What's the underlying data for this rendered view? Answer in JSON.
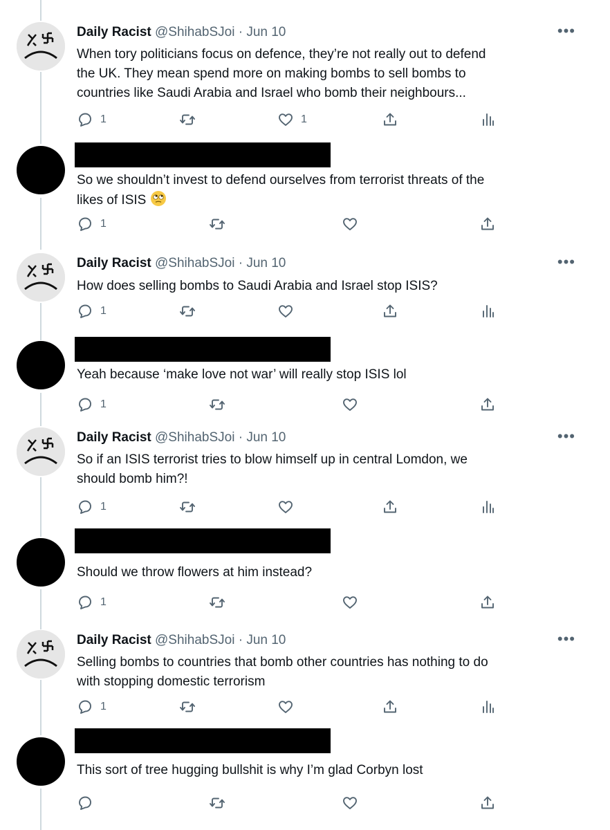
{
  "author": {
    "name": "Daily Racist",
    "handle": "@ShihabSJoi",
    "dot": "·"
  },
  "more_label": "•••",
  "tweets": [
    {
      "type": "author",
      "date": "Jun 10",
      "lines": [
        "When tory politicians focus on defence, they’re not really out to defend",
        "the UK. They mean spend more on making bombs to sell bombs to",
        "countries like Saudi Arabia and Israel who bomb their neighbours..."
      ],
      "reply_count": "1",
      "like_count": "1"
    },
    {
      "type": "reply",
      "lines": [
        "So we shouldn’t invest to defend ourselves from terrorist threats of the",
        "likes of ISIS"
      ],
      "emoji": "rolling-eyes-emoji",
      "reply_count": "1",
      "like_count": ""
    },
    {
      "type": "author",
      "date": "Jun 10",
      "lines": [
        "How does selling bombs to Saudi Arabia and Israel stop ISIS?"
      ],
      "reply_count": "1",
      "like_count": ""
    },
    {
      "type": "reply",
      "lines": [
        "Yeah because ‘make love not war’ will really stop ISIS lol"
      ],
      "reply_count": "1",
      "like_count": ""
    },
    {
      "type": "author",
      "date": "Jun 10",
      "lines": [
        "So if an ISIS terrorist tries to blow himself up in central Lomdon, we",
        "should bomb him?!"
      ],
      "reply_count": "1",
      "like_count": ""
    },
    {
      "type": "reply",
      "lines": [
        "Should we throw flowers at him instead?"
      ],
      "reply_count": "1",
      "like_count": ""
    },
    {
      "type": "author",
      "date": "Jun 10",
      "lines": [
        "Selling bombs to countries that bomb other countries has nothing to do",
        "with stopping domestic terrorism"
      ],
      "reply_count": "1",
      "like_count": ""
    },
    {
      "type": "reply",
      "lines": [
        "This sort of tree hugging bullshit is why I’m glad Corbyn lost"
      ],
      "reply_count": "",
      "like_count": ""
    }
  ],
  "colors": {
    "text": "#0f1419",
    "muted": "#536471",
    "thread_line": "#cfd9de",
    "redaction": "#000000"
  }
}
